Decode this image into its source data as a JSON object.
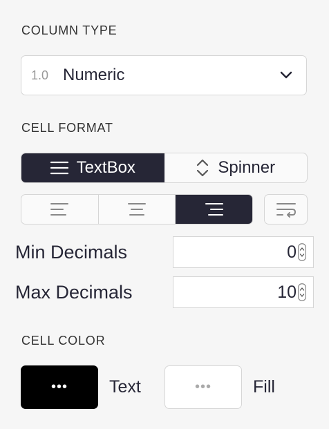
{
  "column_type": {
    "title": "COLUMN TYPE",
    "type_icon": "1.0",
    "selected": "Numeric"
  },
  "cell_format": {
    "title": "CELL FORMAT",
    "widgets": [
      {
        "label": "TextBox",
        "icon": "lines-icon",
        "active": true
      },
      {
        "label": "Spinner",
        "icon": "spinner-icon",
        "active": false
      }
    ],
    "alignment": {
      "selected": "right",
      "options": [
        "left",
        "center",
        "right"
      ]
    },
    "wrap": false
  },
  "decimals": {
    "min_label": "Min Decimals",
    "min_value": "0",
    "max_label": "Max Decimals",
    "max_value": "10"
  },
  "cell_color": {
    "title": "CELL COLOR",
    "text_label": "Text",
    "fill_label": "Fill",
    "text_color": "#000000",
    "fill_color": "#ffffff",
    "swatch_glyph": "•••"
  }
}
